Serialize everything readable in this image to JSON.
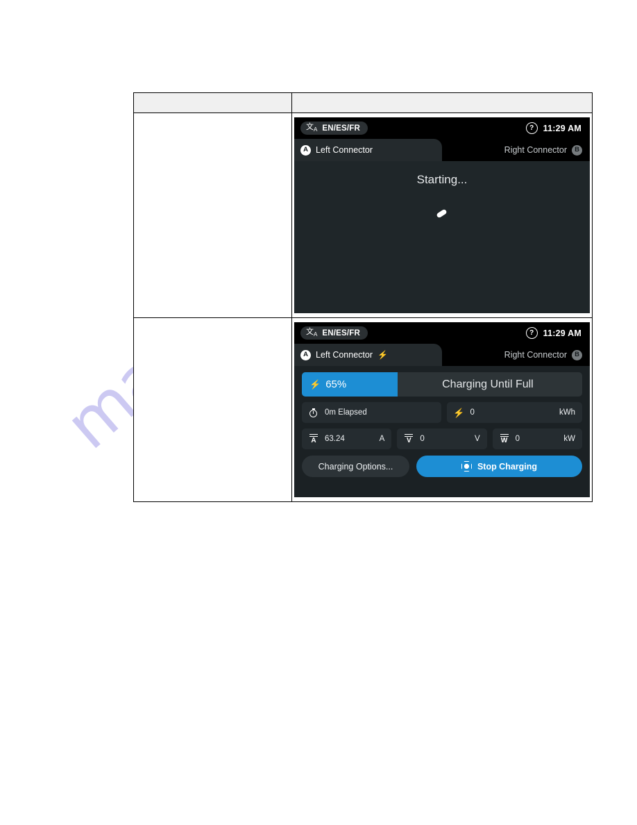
{
  "page": {
    "watermark": "manualslib.com"
  },
  "table": {
    "header": {
      "left": "",
      "right": ""
    },
    "rows": [
      {
        "note": "",
        "screen": "screen_starting"
      },
      {
        "note": "",
        "screen": "screen_charging"
      }
    ]
  },
  "screen_starting": {
    "statusbar": {
      "language_icon": "translate-icon",
      "language_label": "EN/ES/FR",
      "help_icon": "?",
      "time": "11:29 AM"
    },
    "tabs": {
      "left": {
        "badge": "A",
        "label": "Left Connector",
        "active": true,
        "bolt": ""
      },
      "right": {
        "badge": "B",
        "label": "Right Connector",
        "active": false
      }
    },
    "body": {
      "title": "Starting...",
      "spinner": "loading-spinner"
    }
  },
  "screen_charging": {
    "statusbar": {
      "language_icon": "translate-icon",
      "language_label": "EN/ES/FR",
      "help_icon": "?",
      "time": "11:29 AM"
    },
    "tabs": {
      "left": {
        "badge": "A",
        "label": "Left Connector",
        "active": true,
        "bolt": "⚡"
      },
      "right": {
        "badge": "B",
        "label": "Right Connector",
        "active": false
      }
    },
    "progress": {
      "bolt": "⚡",
      "percent_label": "65%",
      "percent_value": 65,
      "status": "Charging Until Full",
      "fill_color": "#1d8ed4"
    },
    "tiles_row1": [
      {
        "icon": "stopwatch-icon",
        "value": "0m Elapsed",
        "unit": ""
      },
      {
        "icon": "bolt-icon",
        "value": "0",
        "unit": "kWh"
      }
    ],
    "tiles_row2": [
      {
        "icon": "ammeter-icon",
        "letter": "A",
        "value": "63.24",
        "unit": "A"
      },
      {
        "icon": "voltmeter-icon",
        "letter": "V",
        "value": "0",
        "unit": "V"
      },
      {
        "icon": "wattmeter-icon",
        "letter": "W",
        "value": "0",
        "unit": "kW"
      }
    ],
    "buttons": {
      "secondary": "Charging Options...",
      "primary": "Stop Charging",
      "primary_icon": "stop-octagon-icon"
    }
  }
}
